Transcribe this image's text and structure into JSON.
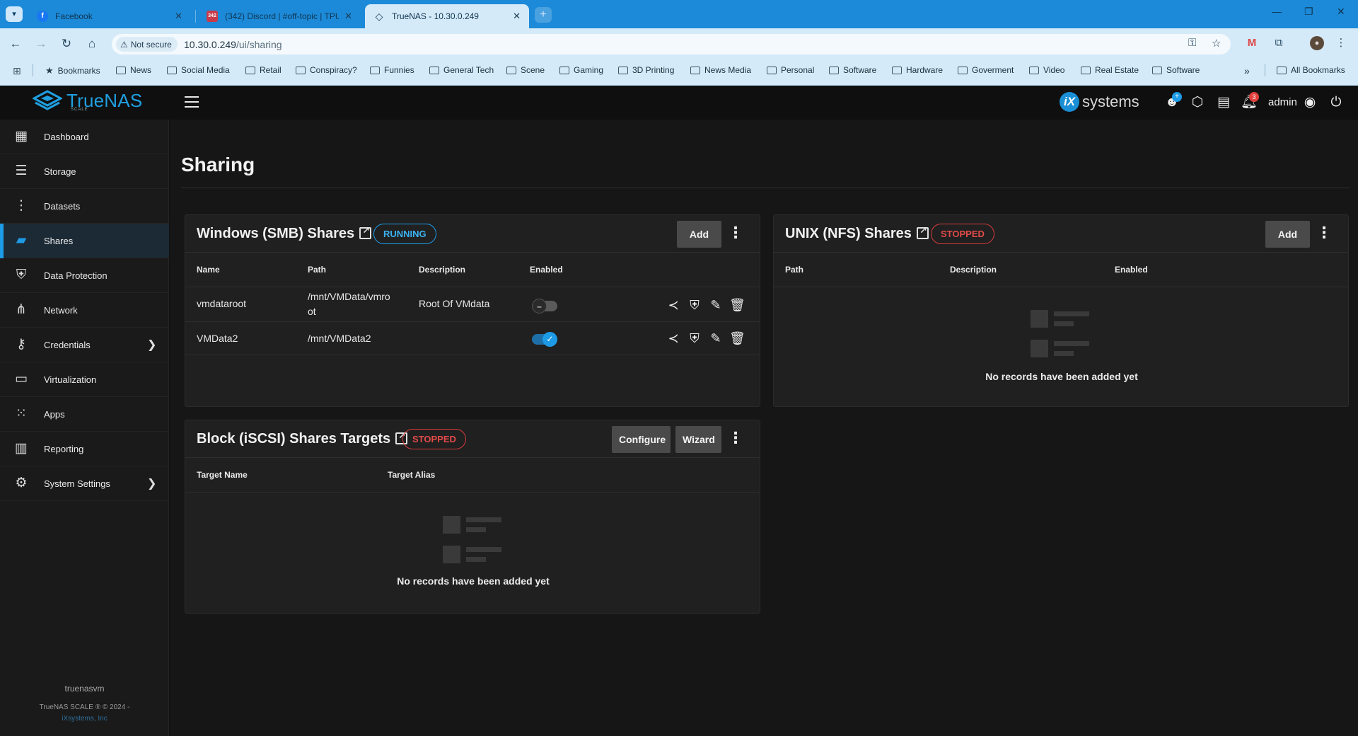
{
  "browser": {
    "tabs": [
      {
        "title": "Facebook",
        "favicon": "f",
        "favicon_color": "#1877f2"
      },
      {
        "title": "(342) Discord | #off-topic | TPU",
        "favicon": "342",
        "favicon_color": "#c93a4b"
      },
      {
        "title": "TrueNAS - 10.30.0.249",
        "favicon": "◇",
        "favicon_color": "#0f3552"
      }
    ],
    "new_tab": "+",
    "security_label": "Not secure",
    "url_host": "10.30.0.249",
    "url_path": "/ui/sharing",
    "bookmarks": [
      "Bookmarks",
      "News",
      "Social Media",
      "Retail",
      "Conspiracy?",
      "Funnies",
      "General Tech",
      "Scene",
      "Gaming",
      "3D Printing",
      "News Media",
      "Personal",
      "Software",
      "Hardware",
      "Goverment",
      "Video",
      "Real Estate",
      "Software"
    ],
    "all_bookmarks": "All Bookmarks",
    "overflow": "»"
  },
  "app": {
    "logo_text": "TrueNAS",
    "logo_sub": "SCALE",
    "vendor_logo": "systems",
    "vendor_mark": "iX",
    "user": "admin",
    "alert_count": "3"
  },
  "sidebar": {
    "items": [
      {
        "label": "Dashboard",
        "icon": "dashboard-icon"
      },
      {
        "label": "Storage",
        "icon": "storage-icon"
      },
      {
        "label": "Datasets",
        "icon": "datasets-icon"
      },
      {
        "label": "Shares",
        "icon": "shares-icon"
      },
      {
        "label": "Data Protection",
        "icon": "shield-icon"
      },
      {
        "label": "Network",
        "icon": "network-icon"
      },
      {
        "label": "Credentials",
        "icon": "key-icon"
      },
      {
        "label": "Virtualization",
        "icon": "monitor-icon"
      },
      {
        "label": "Apps",
        "icon": "apps-grid-icon"
      },
      {
        "label": "Reporting",
        "icon": "reporting-icon"
      },
      {
        "label": "System Settings",
        "icon": "gear-icon"
      }
    ],
    "active": "Shares",
    "hostname": "truenasvm",
    "copyright": "TrueNAS SCALE ® © 2024 -",
    "company": "iXsystems, Inc"
  },
  "page": {
    "title": "Sharing"
  },
  "smb": {
    "title": "Windows (SMB) Shares",
    "status": "RUNNING",
    "add_label": "Add",
    "columns": [
      "Name",
      "Path",
      "Description",
      "Enabled"
    ],
    "rows": [
      {
        "name": "vmdataroot",
        "path": "/mnt/VMData/vmroot",
        "path_line1": "/mnt/VMData/vmro",
        "path_line2": "ot",
        "description": "Root Of VMdata",
        "enabled": false
      },
      {
        "name": "VMData2",
        "path": "/mnt/VMData2",
        "description": "",
        "enabled": true
      }
    ]
  },
  "nfs": {
    "title": "UNIX (NFS) Shares",
    "status": "STOPPED",
    "add_label": "Add",
    "columns": [
      "Path",
      "Description",
      "Enabled"
    ],
    "empty_text": "No records have been added yet"
  },
  "iscsi": {
    "title": "Block (iSCSI) Shares Targets",
    "status": "STOPPED",
    "configure_label": "Configure",
    "wizard_label": "Wizard",
    "columns": [
      "Target Name",
      "Target Alias"
    ],
    "empty_text": "No records have been added yet"
  },
  "colors": {
    "accent": "#1e9be6",
    "running": "#3cb1f2",
    "stopped": "#e34a4a",
    "browser_frame": "#1c8ad8"
  }
}
